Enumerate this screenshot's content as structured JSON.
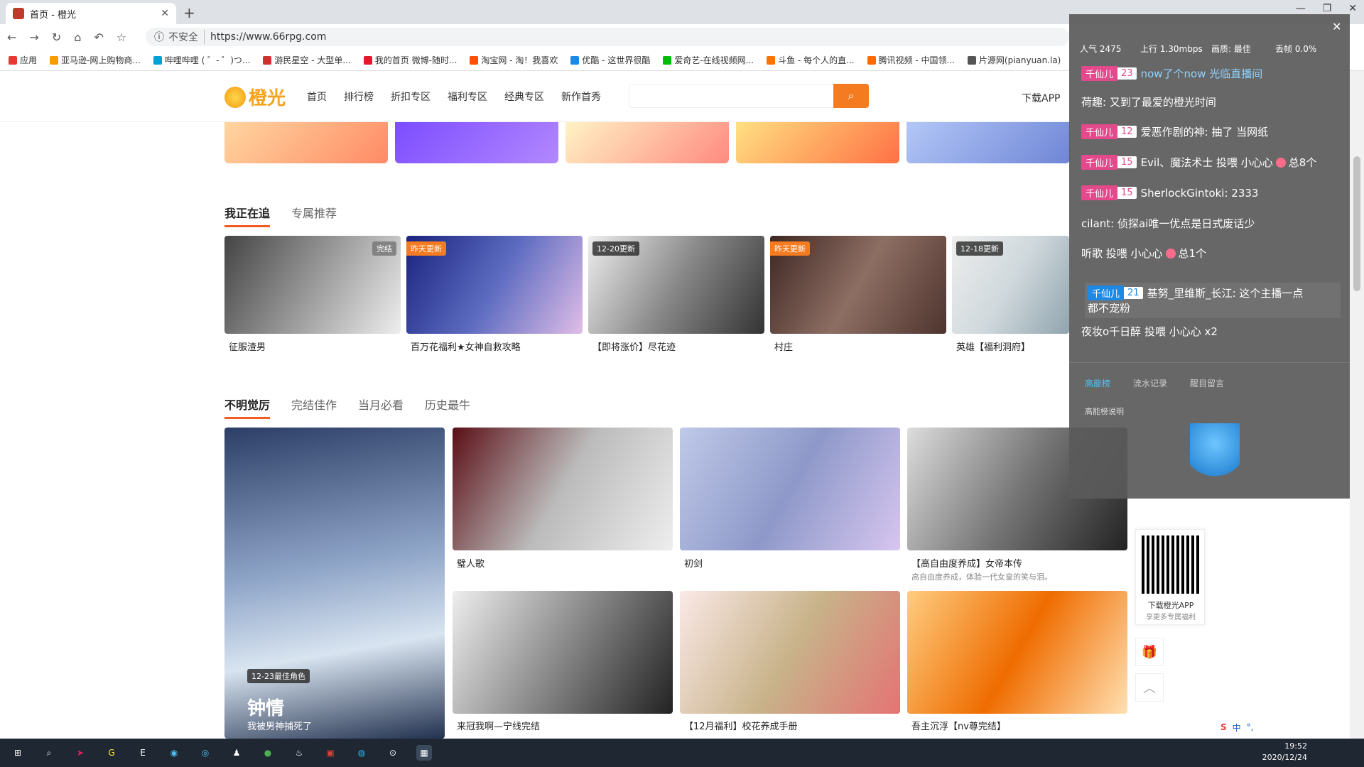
{
  "browser": {
    "tab_title": "首页 - 橙光",
    "address_security": "不安全",
    "url": "https://www.66rpg.com",
    "bookmarks": [
      {
        "label": "应用",
        "color": "#e53935"
      },
      {
        "label": "亚马逊-网上购物商...",
        "color": "#ff9900"
      },
      {
        "label": "哔哩哔哩 ( ゜- ゜)つ...",
        "color": "#00a1d6"
      },
      {
        "label": "游民星空 - 大型单...",
        "color": "#d32f2f"
      },
      {
        "label": "我的首页 微博-随时...",
        "color": "#e6162d"
      },
      {
        "label": "淘宝网 - 淘！我喜欢",
        "color": "#ff5000"
      },
      {
        "label": "优酷 - 这世界很酷",
        "color": "#1e88e5"
      },
      {
        "label": "爱奇艺-在线视频网...",
        "color": "#00be06"
      },
      {
        "label": "斗鱼 - 每个人的直...",
        "color": "#ff7200"
      },
      {
        "label": "腾讯视频 - 中国领...",
        "color": "#ff6a00"
      },
      {
        "label": "片源网(pianyuan.la)",
        "color": "#555555"
      }
    ]
  },
  "site": {
    "logo_text": "橙光",
    "nav": [
      "首页",
      "排行榜",
      "折扣专区",
      "福利专区",
      "经典专区",
      "新作首秀"
    ],
    "download_app": "下载APP",
    "section1": {
      "tabs": [
        "我正在追",
        "专属推荐"
      ],
      "cards": [
        {
          "title": "征服渣男",
          "badge": "完结"
        },
        {
          "title": "百万花福利★女神自救攻略",
          "badge": "昨天更新"
        },
        {
          "title": "【即将涨价】尽花迹",
          "badge": "12-20更新"
        },
        {
          "title": "村庄",
          "badge": "昨天更新"
        },
        {
          "title": "英雄【福利洞府】",
          "badge": "12-18更新"
        }
      ]
    },
    "section2": {
      "tabs": [
        "不明觉厉",
        "完结佳作",
        "当月必看",
        "历史最牛"
      ],
      "feature": {
        "badge": "12-23最佳角色",
        "name": "钟情",
        "caption": "我被男神捕死了"
      },
      "cards": [
        {
          "title": "璧人歌",
          "sub": ""
        },
        {
          "title": "初剑",
          "sub": ""
        },
        {
          "title": "【高自由度养成】女帝本传",
          "sub": "高自由度养成，体验一代女皇的笑与泪。"
        },
        {
          "title": "来冠我啊—宁线完结",
          "sub": ""
        },
        {
          "title": "【12月福利】校花养成手册",
          "sub": ""
        },
        {
          "title": "吾主沉浮【nv尊完结】",
          "sub": ""
        }
      ]
    },
    "qr": {
      "line1": "下载橙光APP",
      "line2": "享更多专属福利"
    }
  },
  "chat_overlay": {
    "stats": {
      "popularity": "人气 2475",
      "upload": "上行 1.30mbps",
      "quality": "画质: 最佳",
      "drop": "丢帧 0.0%"
    },
    "messages": [
      {
        "level_name": "千仙儿",
        "level": "23",
        "text": "now了个now 光临直播间"
      },
      {
        "level_name": "",
        "level": "",
        "text": "荷趣: 又到了最爱的橙光时间"
      },
      {
        "level_name": "千仙儿",
        "level": "12",
        "text": "爱恶作剧的神: 抽了 当网纸"
      },
      {
        "level_name": "千仙儿",
        "level": "15",
        "text": "Evil、魔法术士 投喂 小心心",
        "extra": "总8个"
      },
      {
        "level_name": "千仙儿",
        "level": "15",
        "text": "SherlockGintoki: 2333"
      },
      {
        "level_name": "",
        "level": "",
        "text": "cilant: 侦探ai唯一优点是日式废话少"
      },
      {
        "level_name": "",
        "level": "",
        "text": "听歌 投喂 小心心",
        "extra": "总1个"
      },
      {
        "level_name": "千仙儿",
        "level": "21",
        "text": "基努_里维斯_长江: 这个主播一点"
      },
      {
        "level_name": "",
        "level": "",
        "text": "都不宠粉"
      },
      {
        "level_name": "",
        "level": "",
        "text": "夜妆o千日醉 投喂 小心心 x2"
      }
    ],
    "bottom_tabs": [
      "高能榜",
      "流水记录",
      "醒目留言"
    ],
    "help": "高能榜说明"
  },
  "taskbar": {
    "time": "19:52",
    "date": "2020/12/24",
    "ime": [
      "中",
      "°,"
    ]
  }
}
